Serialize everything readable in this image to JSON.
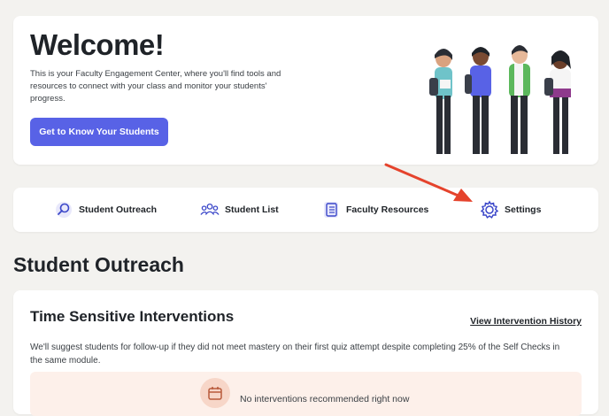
{
  "welcome": {
    "title": "Welcome!",
    "description": "This is your Faculty Engagement Center, where you'll find tools and resources to connect with your class and monitor your students' progress.",
    "cta_label": "Get to Know Your Students"
  },
  "nav": {
    "items": [
      {
        "label": "Student Outreach",
        "icon": "magnifier-icon"
      },
      {
        "label": "Student List",
        "icon": "people-group-icon"
      },
      {
        "label": "Faculty Resources",
        "icon": "document-stack-icon"
      },
      {
        "label": "Settings",
        "icon": "gear-icon"
      }
    ]
  },
  "outreach": {
    "section_title": "Student Outreach",
    "card": {
      "title": "Time Sensitive Interventions",
      "history_link": "View Intervention History",
      "description": "We'll suggest students for follow-up if they did not meet mastery on their first quiz attempt despite completing 25% of the Self Checks in the same module.",
      "empty_text": "No interventions recommended right now",
      "empty_icon": "calendar-icon"
    }
  },
  "colors": {
    "page_bg": "#f3f2ef",
    "card_bg": "#ffffff",
    "accent": "#5862e6",
    "arrow": "#e5432c",
    "empty_bg": "#fdf0ea"
  }
}
